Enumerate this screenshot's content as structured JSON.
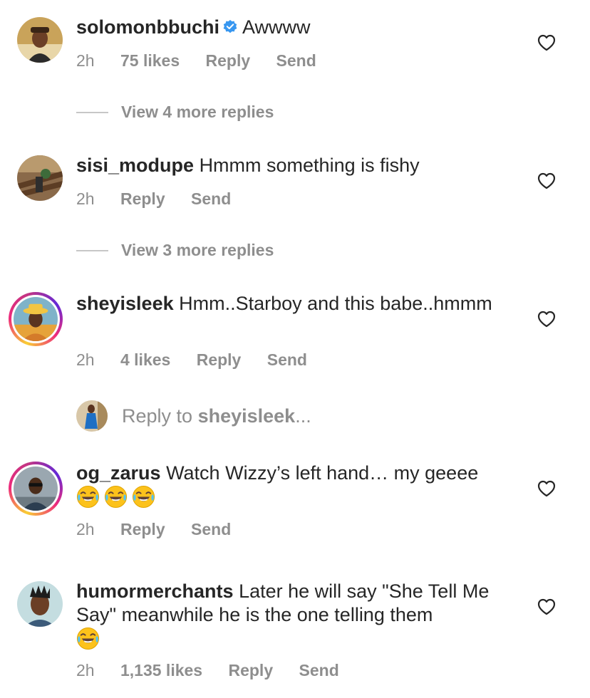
{
  "comments": [
    {
      "username": "solomonbbuchi",
      "verified": true,
      "text": "Awwww",
      "time": "2h",
      "likes": "75 likes",
      "reply": "Reply",
      "send": "Send",
      "more_replies": "View 4 more replies"
    },
    {
      "username": "sisi_modupe",
      "text": "Hmmm something is fishy",
      "time": "2h",
      "reply": "Reply",
      "send": "Send",
      "more_replies": "View 3 more replies"
    },
    {
      "username": "sheyisleek",
      "text": "Hmm..Starboy and this babe..hmmm",
      "time": "2h",
      "likes": "4 likes",
      "reply": "Reply",
      "send": "Send"
    },
    {
      "username": "og_zarus",
      "text": "Watch Wizzy’s left hand… my geeee",
      "time": "2h",
      "reply": "Reply",
      "send": "Send"
    },
    {
      "username": "humormerchants",
      "text": "Later he will say \"She Tell Me Say\" meanwhile he is the one telling them",
      "time": "2h",
      "likes": "1,135 likes",
      "reply": "Reply",
      "send": "Send"
    }
  ],
  "reply_to": {
    "prefix": "Reply to",
    "username": "sheyisleek",
    "suffix": "..."
  },
  "icons": {
    "like": "heart-outline-icon",
    "verified": "verified-badge-icon",
    "emoji": "face-with-tears-of-joy-emoji"
  },
  "colors": {
    "text": "#262626",
    "meta": "#8e8e8e",
    "verified": "#3897f0",
    "story_ring": "#ee2a7b"
  }
}
